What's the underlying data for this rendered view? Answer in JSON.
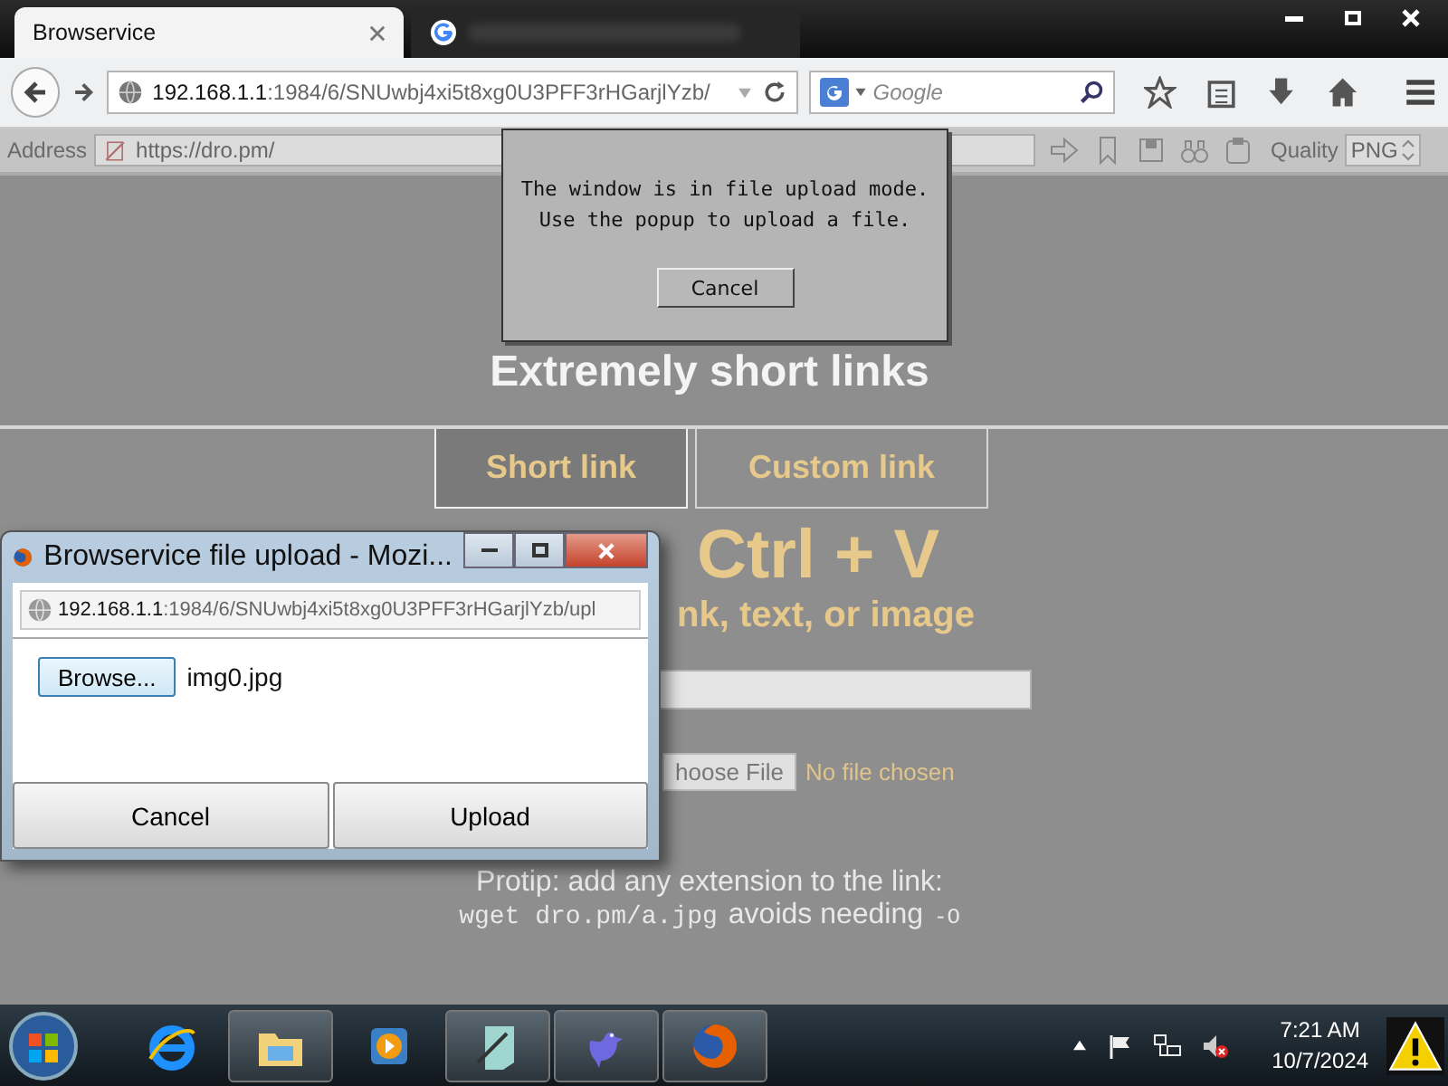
{
  "browser": {
    "tabs": [
      {
        "kind": "text",
        "title": "Browservice",
        "selected": true
      },
      {
        "kind": "redacted",
        "selected": false
      }
    ],
    "url_host": "192.168.1.1",
    "url_path": ":1984/6/SNUwbj4xi5t8xg0U3PFF3rHGarjlYzb/",
    "search_placeholder": "Google"
  },
  "remote_toolbar": {
    "address_label": "Address",
    "address": "https://dro.pm/",
    "quality_label": "Quality",
    "quality": "PNG"
  },
  "page": {
    "title": "Extremely short links",
    "tabs": [
      {
        "label": "Short link",
        "selected": true
      },
      {
        "label": "Custom link",
        "selected": false
      }
    ],
    "headline": "Ctrl + V",
    "subline": "nk, text, or image",
    "file_button": "hoose File",
    "file_status": "No file chosen",
    "protip": "Protip: add any extension to the link:",
    "protip_code": "wget dro.pm/a.jpg",
    "protip_text": "avoids needing",
    "protip_flag": "-O"
  },
  "upload_mode_dialog": {
    "lines": [
      "The window is in file upload mode.",
      "Use the popup to upload a file."
    ],
    "button": "Cancel"
  },
  "popup": {
    "title": "Browservice file upload - Mozi...",
    "url_host": "192.168.1.1",
    "url_path": ":1984/6/SNUwbj4xi5t8xg0U3PFF3rHGarjlYzb/upl",
    "browse_button": "Browse...",
    "file_name": "img0.jpg",
    "buttons": [
      "Cancel",
      "Upload"
    ]
  },
  "taskbar": {
    "apps": [
      {
        "kind": "ie",
        "running": false
      },
      {
        "kind": "explorer",
        "running": true
      },
      {
        "kind": "media",
        "running": false
      },
      {
        "kind": "notes",
        "running": true
      },
      {
        "kind": "bird",
        "running": true
      },
      {
        "kind": "firefox",
        "running": true
      }
    ],
    "time": "7:21 AM",
    "date": "10/7/2024"
  }
}
